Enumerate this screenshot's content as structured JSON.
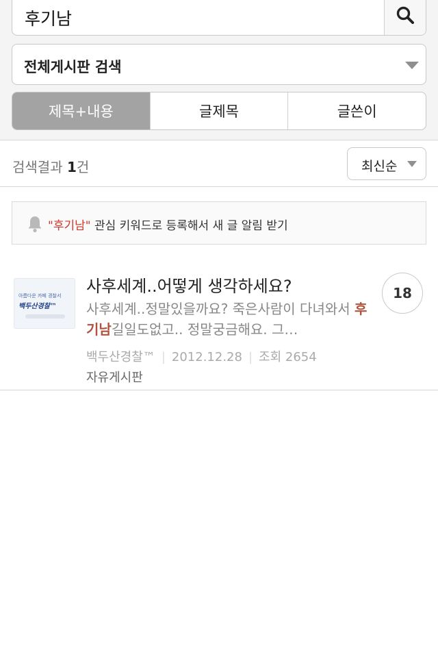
{
  "search": {
    "value": "후기남",
    "icon": "search-icon"
  },
  "board_select": {
    "selected": "전체게시판 검색",
    "icon": "chevron-down-icon"
  },
  "search_scope_tabs": [
    {
      "label": "제목+내용",
      "active": true
    },
    {
      "label": "글제목",
      "active": false
    },
    {
      "label": "글쓴이",
      "active": false
    }
  ],
  "results": {
    "prefix": "검색결과 ",
    "count": "1",
    "suffix": "건"
  },
  "sort": {
    "selected": "최신순",
    "icon": "chevron-down-icon"
  },
  "keyword_banner": {
    "icon": "bell-icon",
    "keyword": "\"후기남\"",
    "text": " 관심 키워드로 등록해서 새 글 알림 받기"
  },
  "posts": [
    {
      "thumbnail": {
        "line1": "아름다운 카페 경찰서",
        "line2": "백두산경찰™"
      },
      "title": "사후세계..어떻게 생각하세요?",
      "snippet_before": "사후세계..정말있을까요? 죽은사람이 다녀와서 ",
      "snippet_keyword": "후기남",
      "snippet_after": "길일도없고.. 정말궁금해요. 그…",
      "author": "백두산경찰™",
      "date": "2012.12.28",
      "views": "조회 2654",
      "board": "자유게시판",
      "comments": "18"
    }
  ],
  "colors": {
    "accent_red": "#d0352a",
    "active_tab_bg": "#a3a3a3",
    "header_bg": "#f4f4f4"
  }
}
